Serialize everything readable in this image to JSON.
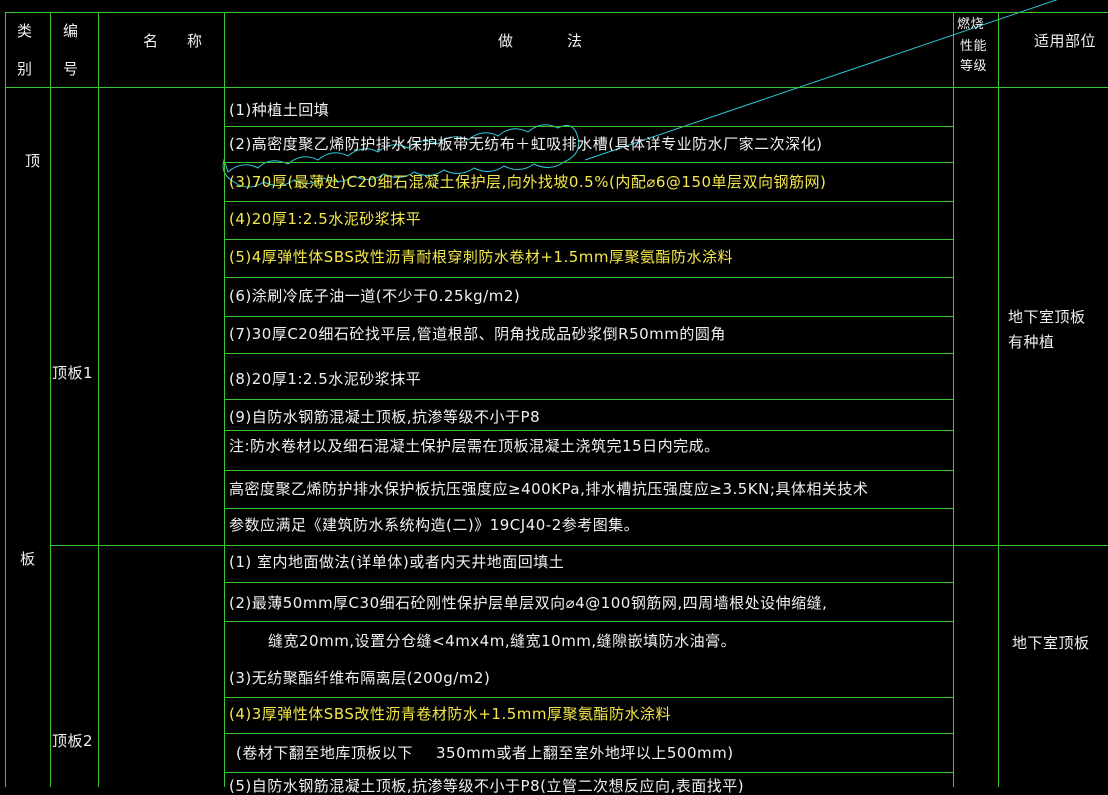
{
  "colors": {
    "background": "#000000",
    "grid": "#39c832",
    "text": "#f0f0f0",
    "highlight": "#f5e84a",
    "leader": "#2ec6d8",
    "cloud": "#2ec6d8"
  },
  "header": {
    "col_category": [
      "类",
      "别"
    ],
    "col_code": [
      "编",
      "号"
    ],
    "col_name": [
      "名",
      "称"
    ],
    "col_method": [
      "做",
      "法"
    ],
    "col_fire": [
      "燃烧",
      "性能",
      "等级"
    ],
    "col_location": "适用部位"
  },
  "category": {
    "top": "顶",
    "slab": "板"
  },
  "board1": {
    "code": "顶板1",
    "location": [
      "地下室顶板",
      "有种植"
    ],
    "items": [
      "(1)种植土回填",
      "(2)高密度聚乙烯防护排水保护板带无纺布＋虹吸排水槽(具体详专业防水厂家二次深化)",
      "(3)70厚(最薄处)C20细石混凝土保护层,向外找坡0.5%(内配⌀6@150单层双向钢筋网)",
      "(4)20厚1:2.5水泥砂浆抹平",
      "(5)4厚弹性体SBS改性沥青耐根穿刺防水卷材+1.5mm厚聚氨酯防水涂料",
      "(6)涂刷冷底子油一道(不少于0.25kg/m2)",
      "(7)30厚C20细石砼找平层,管道根部、阴角找成品砂浆倒R50mm的圆角",
      "(8)20厚1:2.5水泥砂浆抹平",
      "(9)自防水钢筋混凝土顶板,抗渗等级不小于P8",
      "注:防水卷材以及细石混凝土保护层需在顶板混凝土浇筑完15日内完成。",
      "高密度聚乙烯防护排水保护板抗压强度应≥400KPa,排水槽抗压强度应≥3.5KN;具体相关技术",
      "参数应满足《建筑防水系统构造(二)》19CJ40-2参考图集。"
    ]
  },
  "board2": {
    "code": "顶板2",
    "location": "地下室顶板",
    "items": [
      "(1) 室内地面做法(详单体)或者内天井地面回填土",
      "(2)最薄50mm厚C30细石砼刚性保护层单层双向⌀4@100钢筋网,四周墙根处设伸缩缝,",
      "缝宽20mm,设置分仓缝<4mx4m,缝宽10mm,缝隙嵌填防水油膏。",
      "(3)无纺聚酯纤维布隔离层(200g/m2)",
      "(4)3厚弹性体SBS改性沥青卷材防水+1.5mm厚聚氨酯防水涂料",
      "(卷材下翻至地库顶板以下",
      "350mm或者上翻至室外地坪以上500mm)",
      "(5)自防水钢筋混凝土顶板,抗渗等级不小于P8(立管二次想反应向,表面找平)"
    ]
  }
}
